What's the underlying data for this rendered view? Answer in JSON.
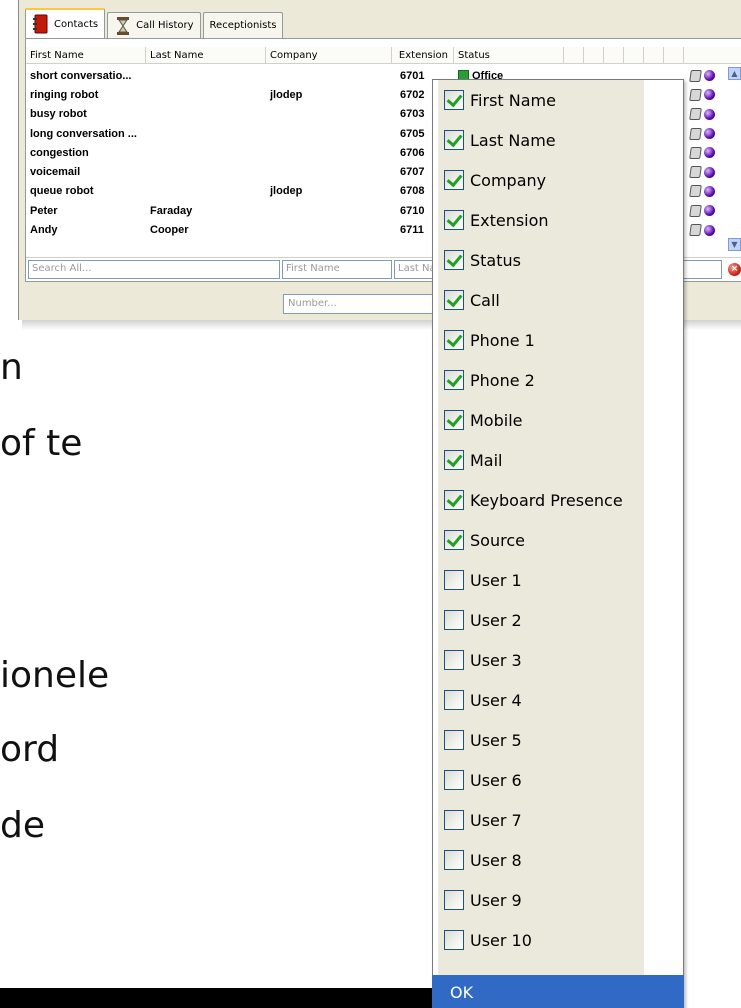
{
  "tabs": [
    {
      "label": "Contacts",
      "icon": "address-book-icon",
      "active": true
    },
    {
      "label": "Call History",
      "icon": "hourglass-icon",
      "active": false
    },
    {
      "label": "Receptionists",
      "icon": "",
      "active": false
    }
  ],
  "columns": {
    "first_name": "First Name",
    "last_name": "Last Name",
    "company": "Company",
    "extension": "Extension",
    "status": "Status"
  },
  "contacts": [
    {
      "first": "short conversatio...",
      "last": "",
      "company": "",
      "ext": "6701",
      "status": "Office"
    },
    {
      "first": "ringing robot",
      "last": "",
      "company": "jlodep",
      "ext": "6702",
      "status": ""
    },
    {
      "first": "busy robot",
      "last": "",
      "company": "",
      "ext": "6703",
      "status": ""
    },
    {
      "first": "long conversation ...",
      "last": "",
      "company": "",
      "ext": "6705",
      "status": ""
    },
    {
      "first": "congestion",
      "last": "",
      "company": "",
      "ext": "6706",
      "status": ""
    },
    {
      "first": "voicemail",
      "last": "",
      "company": "",
      "ext": "6707",
      "status": ""
    },
    {
      "first": "queue robot",
      "last": "",
      "company": "jlodep",
      "ext": "6708",
      "status": ""
    },
    {
      "first": "Peter",
      "last": "Faraday",
      "company": "",
      "ext": "6710",
      "status": ""
    },
    {
      "first": "Andy",
      "last": "Cooper",
      "company": "",
      "ext": "6711",
      "status": ""
    }
  ],
  "filters": {
    "search_all": "Search All...",
    "first_name": "First Name",
    "last_name": "Last Na",
    "number": "Number..."
  },
  "slide_text": [
    "n",
    "of te",
    "ionele",
    "ord",
    "de"
  ],
  "column_chooser": {
    "options": [
      {
        "label": "First Name",
        "checked": true
      },
      {
        "label": "Last Name",
        "checked": true
      },
      {
        "label": "Company",
        "checked": true
      },
      {
        "label": "Extension",
        "checked": true
      },
      {
        "label": "Status",
        "checked": true
      },
      {
        "label": "Call",
        "checked": true
      },
      {
        "label": "Phone 1",
        "checked": true
      },
      {
        "label": "Phone 2",
        "checked": true
      },
      {
        "label": "Mobile",
        "checked": true
      },
      {
        "label": "Mail",
        "checked": true
      },
      {
        "label": "Keyboard Presence",
        "checked": true
      },
      {
        "label": "Source",
        "checked": true
      },
      {
        "label": "User 1",
        "checked": false
      },
      {
        "label": "User 2",
        "checked": false
      },
      {
        "label": "User 3",
        "checked": false
      },
      {
        "label": "User 4",
        "checked": false
      },
      {
        "label": "User 5",
        "checked": false
      },
      {
        "label": "User 6",
        "checked": false
      },
      {
        "label": "User 7",
        "checked": false
      },
      {
        "label": "User 8",
        "checked": false
      },
      {
        "label": "User 9",
        "checked": false
      },
      {
        "label": "User 10",
        "checked": false
      }
    ],
    "ok_label": "OK"
  },
  "colors": {
    "accent": "#316ac5",
    "window_bg": "#ece9d8",
    "check": "#21a121"
  }
}
